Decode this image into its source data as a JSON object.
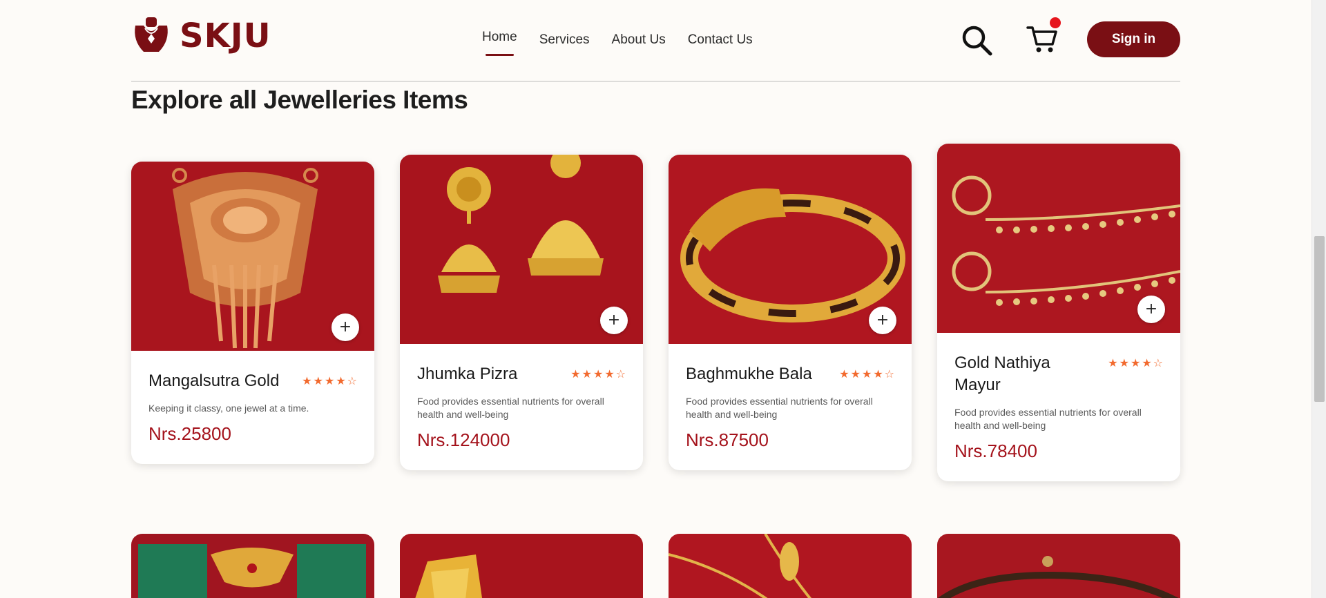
{
  "brand": {
    "name": "SKJU",
    "color": "#7a0f14"
  },
  "nav": {
    "items": [
      {
        "label": "Home",
        "active": true
      },
      {
        "label": "Services",
        "active": false
      },
      {
        "label": "About Us",
        "active": false
      },
      {
        "label": "Contact Us",
        "active": false
      }
    ]
  },
  "header": {
    "search_icon": "search-icon",
    "cart_icon": "cart-icon",
    "signin_label": "Sign in"
  },
  "section": {
    "title": "Explore all Jewelleries Items"
  },
  "products": [
    {
      "name": "Mangalsutra Gold",
      "rating": 4,
      "description": "Keeping it classy, one jewel at a time.",
      "price": "Nrs.25800"
    },
    {
      "name": "Jhumka Pizra",
      "rating": 4,
      "description": "Food provides essential nutrients for overall health and well-being",
      "price": "Nrs.124000"
    },
    {
      "name": "Baghmukhe Bala",
      "rating": 4,
      "description": "Food provides essential nutrients for overall health and well-being",
      "price": "Nrs.87500"
    },
    {
      "name": "Gold Nathiya Mayur",
      "rating": 4,
      "description": "Food provides essential nutrients for overall health and well-being",
      "price": "Nrs.78400"
    }
  ],
  "add_button_label": "+",
  "colors": {
    "accent": "#7a0f14",
    "price": "#a4121b",
    "star": "#f26a2e",
    "cart_badge": "#e6151c"
  }
}
